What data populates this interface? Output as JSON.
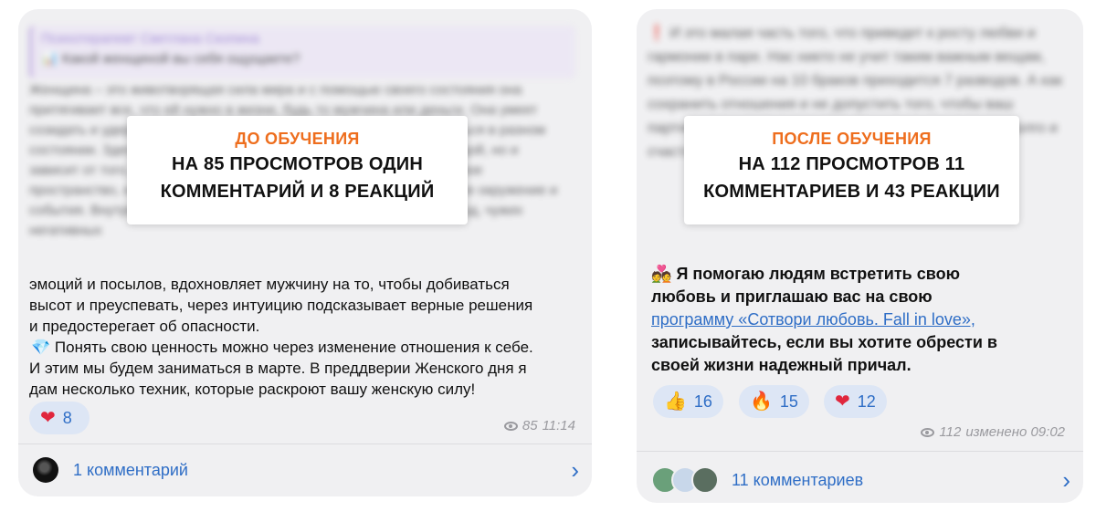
{
  "left_post": {
    "overlay": {
      "title": "ДО ОБУЧЕНИЯ",
      "line1": "НА 85 ПРОСМОТРОВ ОДИН",
      "line2": "КОММЕНТАРИЙ И 8 РЕАКЦИЙ"
    },
    "visible_lines": [
      "эмоций и посылов, вдохновляет мужчину на то, чтобы добиваться",
      "высот и преуспевать, через интуицию подсказывает верные решения",
      "и предостерегает об опасности.",
      "Понять свою ценность можно через изменение отношения к себе.",
      "И этим мы будем заниматься в марте. В преддверии Женского дня я",
      "дам несколько техник, которые раскроют вашу женскую силу!"
    ],
    "reactions": [
      {
        "icon": "heart-icon",
        "count": "8"
      }
    ],
    "views": "85",
    "time": "11:14",
    "comments_label": "1 комментарий"
  },
  "right_post": {
    "overlay": {
      "title": "ПОСЛЕ ОБУЧЕНИЯ",
      "line1": "НА 112 ПРОСМОТРОВ 11",
      "line2": "КОММЕНТАРИЕВ И 43 РЕАКЦИИ"
    },
    "text_intro": "Я помогаю людям встретить свою",
    "text_line2": "любовь и приглашаю вас на свою",
    "link_text": "программу «Сотвори любовь. Fall in love»,",
    "text_line4": "записывайтесь, если вы хотите обрести в",
    "text_line5": "своей жизни надежный причал.",
    "reactions": [
      {
        "icon": "thumbs-up-icon",
        "count": "16"
      },
      {
        "icon": "fire-icon",
        "count": "15"
      },
      {
        "icon": "heart-icon",
        "count": "12"
      }
    ],
    "views": "112",
    "edited_time": "изменено 09:02",
    "comments_label": "11 комментариев"
  },
  "colors": {
    "accent_orange": "#ee6e1e",
    "link_blue": "#2f6ec6",
    "bubble_bg": "#f0f0f2"
  }
}
